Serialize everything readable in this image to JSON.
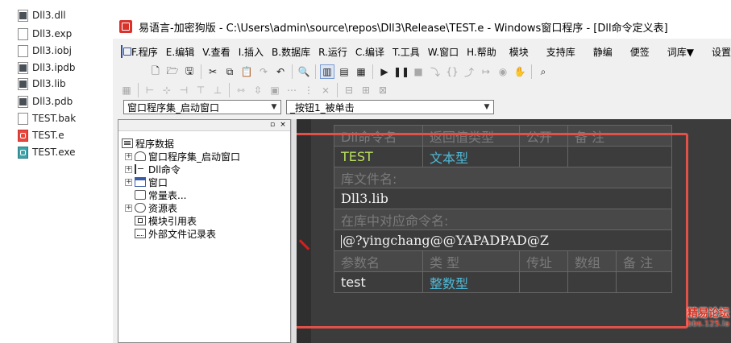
{
  "explorer": {
    "files": [
      {
        "name": "Dll3.dll",
        "icon": "dll-file-icon"
      },
      {
        "name": "Dll3.exp",
        "icon": "exp-file-icon"
      },
      {
        "name": "Dll3.iobj",
        "icon": "iobj-file-icon"
      },
      {
        "name": "Dll3.ipdb",
        "icon": "ipdb-file-icon"
      },
      {
        "name": "Dll3.lib",
        "icon": "lib-file-icon"
      },
      {
        "name": "Dll3.pdb",
        "icon": "pdb-file-icon"
      },
      {
        "name": "TEST.bak",
        "icon": "bak-file-icon"
      },
      {
        "name": "TEST.e",
        "icon": "e-source-file-icon"
      },
      {
        "name": "TEST.exe",
        "icon": "exe-file-icon"
      }
    ]
  },
  "window": {
    "title": "易语言-加密狗版 - C:\\Users\\admin\\source\\repos\\Dll3\\Release\\TEST.e - Windows窗口程序 - [Dll命令定义表]"
  },
  "menu": {
    "items": [
      "F.程序",
      "E.编辑",
      "V.查看",
      "I.插入",
      "B.数据库",
      "R.运行",
      "C.编译",
      "T.工具",
      "W.窗口",
      "H.帮助",
      "模块",
      "支持库",
      "静编",
      "便签",
      "词库▼",
      "设置▼"
    ]
  },
  "selectors": {
    "assembly": "窗口程序集_启动窗口",
    "event": "_按钮1_被单击"
  },
  "tree": {
    "root": "程序数据",
    "nodes": [
      "窗口程序集_启动窗口",
      "Dll命令",
      "窗口",
      "常量表...",
      "资源表",
      "模块引用表",
      "外部文件记录表"
    ]
  },
  "dll_table": {
    "header": [
      "Dll命令名",
      "返回值类型",
      "公开",
      "备 注"
    ],
    "command_name": "TEST",
    "return_type": "文本型",
    "lib_label": "库文件名:",
    "lib_value": "Dll3.lib",
    "entry_label": "在库中对应命令名:",
    "entry_value": "@?yingchang@@YAPADPAD@Z",
    "param_header": [
      "参数名",
      "类 型",
      "传址",
      "数组",
      "备 注"
    ],
    "params": [
      {
        "name": "test",
        "type": "整数型"
      }
    ]
  },
  "watermark": {
    "line1": "精易论坛",
    "line2": "bbs.125.la"
  },
  "colors": {
    "editor_bg": "#3c3c3c",
    "highlight_border": "#e0514a",
    "name_green": "#b8de5e",
    "type_blue": "#4fb9d7"
  }
}
